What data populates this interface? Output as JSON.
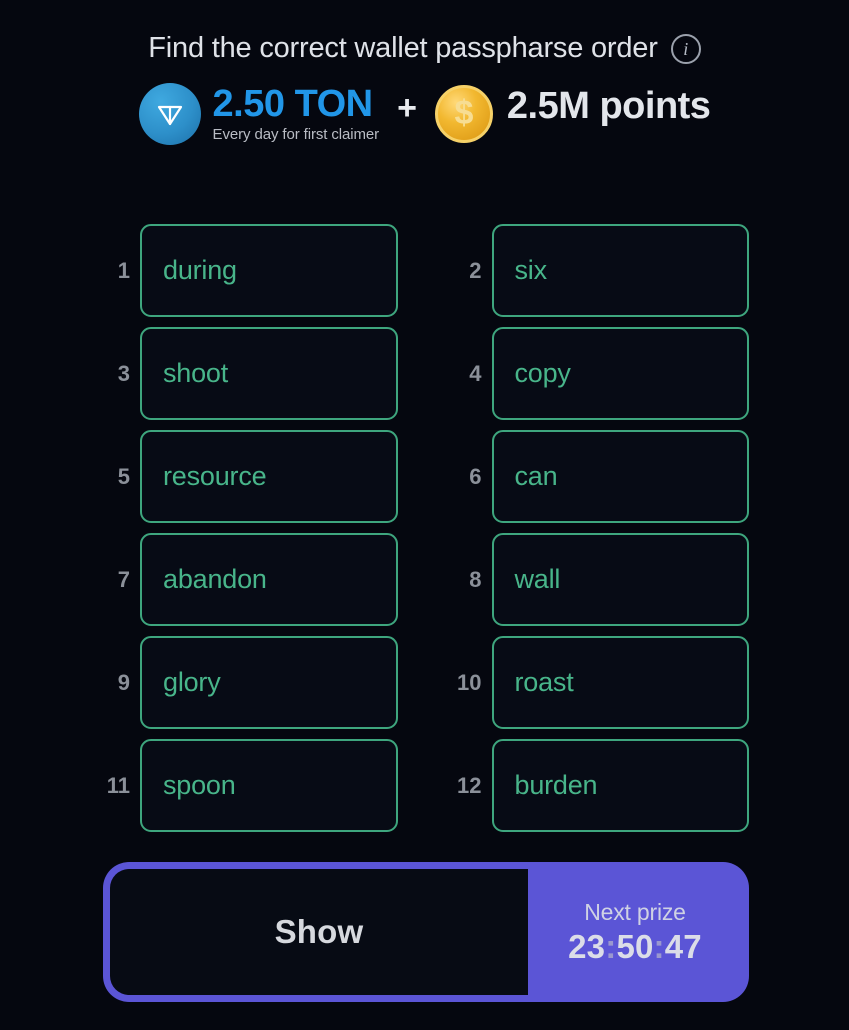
{
  "header": {
    "title": "Find the correct wallet passpharse order",
    "info_icon": "info-icon",
    "info_glyph": "i"
  },
  "prize": {
    "ton_icon": "ton-logo-icon",
    "ton_amount": "2.50 TON",
    "ton_subtext": "Every day for first claimer",
    "plus": "+",
    "coin_icon": "dollar-coin-icon",
    "coin_glyph": "$",
    "points_amount": "2.5M points",
    "ton_color": "#2196e8",
    "points_color": "#e3e6eb"
  },
  "words": [
    {
      "index": "1",
      "word": "during"
    },
    {
      "index": "2",
      "word": "six"
    },
    {
      "index": "3",
      "word": "shoot"
    },
    {
      "index": "4",
      "word": "copy"
    },
    {
      "index": "5",
      "word": "resource"
    },
    {
      "index": "6",
      "word": "can"
    },
    {
      "index": "7",
      "word": "abandon"
    },
    {
      "index": "8",
      "word": "wall"
    },
    {
      "index": "9",
      "word": "glory"
    },
    {
      "index": "10",
      "word": "roast"
    },
    {
      "index": "11",
      "word": "spoon"
    },
    {
      "index": "12",
      "word": "burden"
    }
  ],
  "word_style": {
    "border_color": "#3ea67e",
    "text_color": "#48b58a",
    "index_color": "#8b9099",
    "fill_color": "#070b15"
  },
  "action_bar": {
    "show_label": "Show",
    "next_prize_caption": "Next prize",
    "timer_hours": "23",
    "timer_minutes": "50",
    "timer_seconds": "47",
    "timer_separator": ":",
    "accent_color": "#5b55d6"
  },
  "background_color": "#05070f"
}
